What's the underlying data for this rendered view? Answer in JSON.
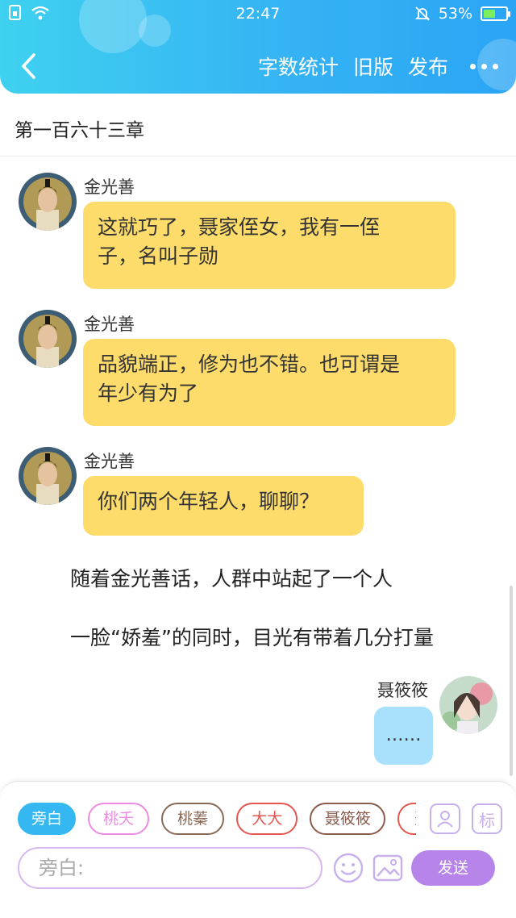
{
  "status_bar": {
    "time": "22:47",
    "battery": "53%",
    "battery_level": 0.53,
    "icons": [
      "sim-icon",
      "wifi-icon",
      "mute-bell-icon",
      "battery-icon"
    ]
  },
  "toolbar": {
    "word_count_label": "字数统计",
    "old_version_label": "旧版",
    "publish_label": "发布",
    "icons": [
      "back-chevron-icon",
      "more-dots-icon"
    ]
  },
  "chapter": {
    "title": "第一百六十三章"
  },
  "messages": [
    {
      "speaker": "金光善",
      "text_lines": [
        "这就巧了，聂家侄女，我有一侄",
        "子，名叫子勋"
      ]
    },
    {
      "speaker": "金光善",
      "text_lines": [
        "品貌端正，修为也不错。也可谓是",
        "年少有为了"
      ]
    },
    {
      "speaker": "金光善",
      "text_lines": [
        "你们两个年轻人，聊聊？"
      ]
    }
  ],
  "narration": [
    "随着金光善话，人群中站起了一个人",
    "一脸“娇羞”的同时，目光有带着几分打量"
  ],
  "reply": {
    "speaker": "聂筱筱",
    "text": "……"
  },
  "role_chips": [
    {
      "label": "旁白",
      "selected": true,
      "color": "#35b8f1"
    },
    {
      "label": "桃夭",
      "selected": false,
      "color": "#ee8be0"
    },
    {
      "label": "桃蓁",
      "selected": false,
      "color": "#8a6a55"
    },
    {
      "label": "大大",
      "selected": false,
      "color": "#e4564f"
    },
    {
      "label": "聂筱筱",
      "selected": false,
      "color": "#8a5a4a"
    },
    {
      "label": "聂",
      "selected": false,
      "color": "#e4564f"
    }
  ],
  "side_buttons": {
    "role_icon": "user-card-icon",
    "mark_label": "标"
  },
  "input": {
    "placeholder": "旁白:"
  },
  "send_label": "发送",
  "colors": {
    "header": "#35b3f3",
    "bubble": "#fddc6c",
    "reply_bubble": "#a9e0fb",
    "send": "#b784ea"
  }
}
